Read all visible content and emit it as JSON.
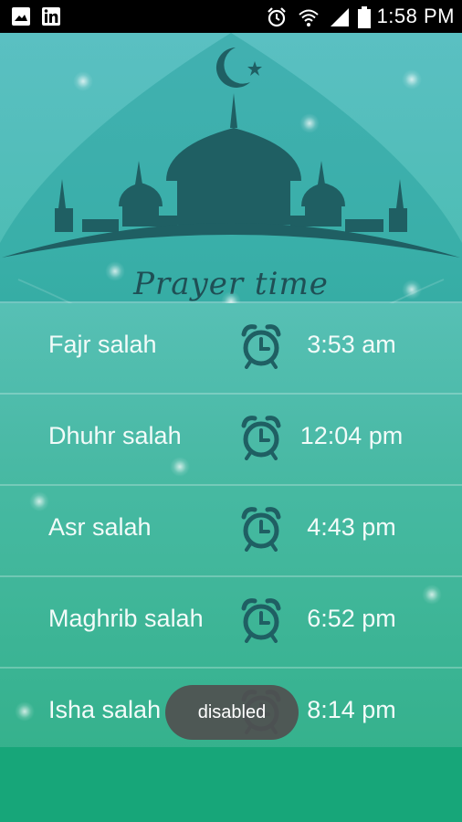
{
  "status_bar": {
    "time": "1:58 PM",
    "left_icons": [
      "gallery-icon",
      "linkedin-icon"
    ],
    "right_icons": [
      "alarm-clock-icon",
      "wifi-icon",
      "signal-icon",
      "battery-icon"
    ]
  },
  "header": {
    "title": "Prayer time",
    "emblem": "crescent-star-mosque-icon"
  },
  "prayers": [
    {
      "name": "Fajr salah",
      "time": "3:53 am"
    },
    {
      "name": "Dhuhr salah",
      "time": "12:04 pm"
    },
    {
      "name": "Asr salah",
      "time": "4:43 pm"
    },
    {
      "name": "Maghrib salah",
      "time": "6:52 pm"
    },
    {
      "name": "Isha salah",
      "time": "8:14 pm"
    }
  ],
  "toast": {
    "text": "disabled"
  },
  "colors": {
    "primary_dark": "#1f5f63",
    "accent_green": "#17a679",
    "teal": "#4ebdb5"
  }
}
